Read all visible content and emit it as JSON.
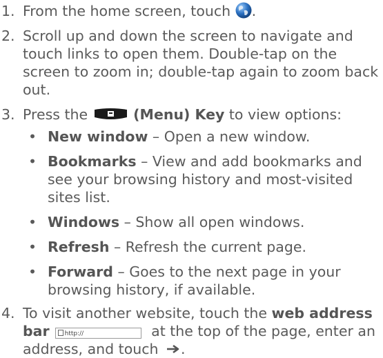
{
  "steps": [
    {
      "num": "1.",
      "before_icon": "From the home screen, touch ",
      "icon": "browser-globe-icon",
      "after_icon": "."
    },
    {
      "num": "2.",
      "text": "Scroll up and down the screen to navigate and touch links to open them. Double-tap on the screen to zoom in; double-tap again to zoom back out."
    },
    {
      "num": "3.",
      "before": "Press the ",
      "icon": "menu-key-icon",
      "key_label": "(Menu) Key",
      "after": " to view options:",
      "options": [
        {
          "term": "New window",
          "desc": " – Open a new window."
        },
        {
          "term": "Bookmarks",
          "desc": " – View and add bookmarks and see your browsing history and most-visited sites list."
        },
        {
          "term": "Windows",
          "desc": " – Show all open windows."
        },
        {
          "term": "Refresh",
          "desc": " – Refresh the current page."
        },
        {
          "term": "Forward",
          "desc": " – Goes to the next page in your browsing history, if available."
        }
      ]
    },
    {
      "num": "4.",
      "before": "To visit another website, touch the ",
      "term": "web address bar",
      "url_text": "http://",
      "middle": " at the top of the page, enter an address, and touch ",
      "icon": "arrow-right-icon",
      "end": "."
    }
  ],
  "bullet": "•",
  "colors": {
    "text": "#5a5a5a",
    "globe": "#1f5fa8",
    "menu_key": "#1a1a1a"
  }
}
